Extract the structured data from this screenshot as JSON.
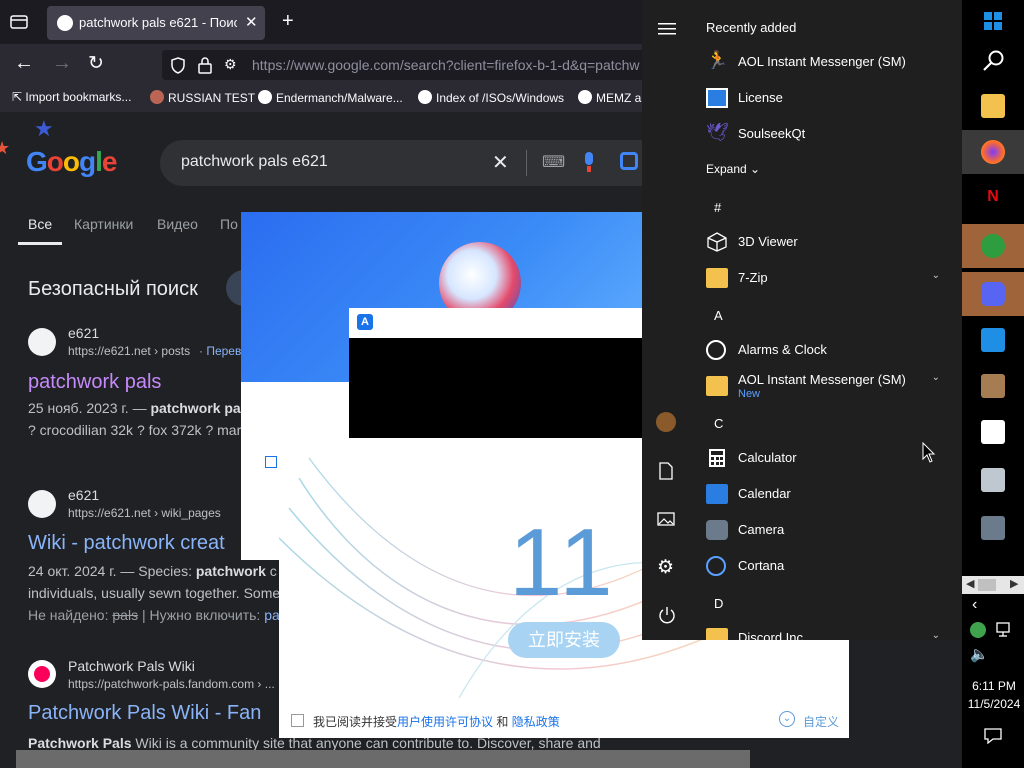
{
  "browser": {
    "tab_title": "patchwork pals e621 - Поиск в",
    "url": "https://www.google.com/search?client=firefox-b-1-d&q=patchw",
    "bookmarks": [
      "Import bookmarks...",
      "RUSSIAN TEST",
      "Endermanch/Malware...",
      "Index of /ISOs/Windows",
      "MEMZ a"
    ]
  },
  "google": {
    "query": "patchwork pals e621",
    "tabs": [
      "Все",
      "Картинки",
      "Видео",
      "По"
    ],
    "safe_search": "Безопасный поиск",
    "results": [
      {
        "site": "e621",
        "url": "https://e621.net › posts",
        "url_extra": "· Переве",
        "title": "patchwork pals",
        "snippet1_date": "25 нояб. 2023 г. — ",
        "snippet1_bold": "patchwork pa",
        "snippet2": "? crocodilian 32k ? fox 372k ? mar"
      },
      {
        "site": "e621",
        "url": "https://e621.net › wiki_pages",
        "url_extra": "· ",
        "title": "Wiki - patchwork creat",
        "snippet1_date": "24 окт. 2024 г. — Species: ",
        "snippet1_bold": "patchwork",
        "snippet1_rest": " c",
        "snippet2": "individuals, usually sewn together. Some",
        "snippet3_pre": "Не найдено: ",
        "snippet3_strike": "pals",
        "snippet3_mid": " | Нужно включить: ",
        "snippet3_link": "pa"
      },
      {
        "site": "Patchwork Pals Wiki",
        "url": "https://patchwork-pals.fandom.com › ...",
        "title": "Patchwork Pals Wiki - Fan",
        "snippet_bold": "Patchwork Pals",
        "snippet_rest": " Wiki is a community site that anyone can contribute to. Discover, share and"
      }
    ]
  },
  "installer": {
    "big_number": "11",
    "install_button": "立即安装",
    "agree_prefix": "我已阅读并接受",
    "license_link": "用户使用许可协议",
    "and": "和",
    "privacy_link": "隐私政策",
    "custom": "自定义"
  },
  "start_menu": {
    "recently_added_title": "Recently added",
    "recent": [
      "AOL Instant Messenger (SM)",
      "License",
      "SoulseekQt"
    ],
    "expand": "Expand",
    "groups": [
      {
        "letter": "#",
        "apps": [
          {
            "name": "3D Viewer"
          },
          {
            "name": "7-Zip",
            "folder": true
          }
        ]
      },
      {
        "letter": "A",
        "apps": [
          {
            "name": "Alarms & Clock"
          },
          {
            "name": "AOL Instant Messenger (SM)",
            "folder": true,
            "badge": "New"
          }
        ]
      },
      {
        "letter": "C",
        "apps": [
          {
            "name": "Calculator"
          },
          {
            "name": "Calendar"
          },
          {
            "name": "Camera"
          },
          {
            "name": "Cortana"
          }
        ]
      },
      {
        "letter": "D",
        "apps": [
          {
            "name": "Discord Inc",
            "folder": true
          }
        ]
      }
    ]
  },
  "taskbar": {
    "time": "6:11 PM",
    "date": "11/5/2024"
  },
  "colors": {
    "link_visited": "#c58af9",
    "link": "#8ab4f8",
    "install_blue": "#1a73e8"
  }
}
